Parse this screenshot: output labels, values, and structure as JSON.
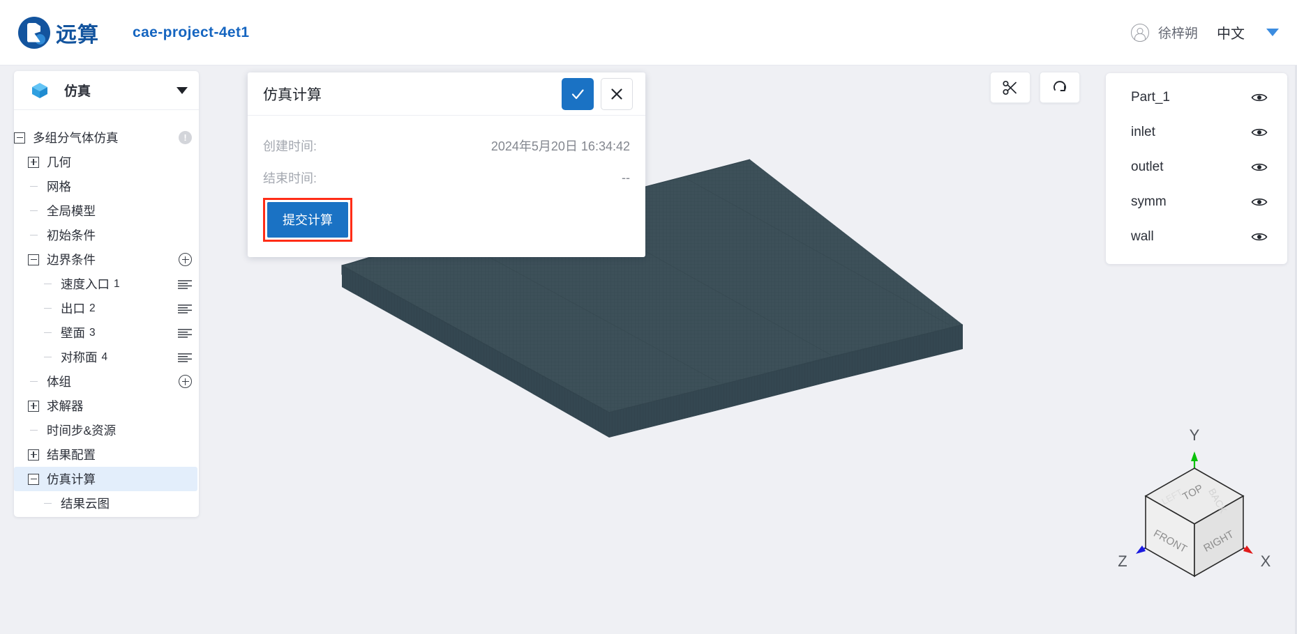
{
  "topbar": {
    "brand_name": "远算",
    "project_title": "cae-project-4et1",
    "user_name": "徐梓朔",
    "language": "中文",
    "avatar_icon": "user-circle-icon",
    "caret_icon": "chevron-down-icon"
  },
  "sidebar": {
    "header_title": "仿真",
    "header_icon": "cube-icon",
    "collapse_icon": "chevron-down-icon",
    "tree": [
      {
        "label": "多组分气体仿真",
        "toggle": "minus",
        "indent": 0,
        "badge": "!",
        "selected": false
      },
      {
        "label": "几何",
        "toggle": "plus",
        "indent": 1,
        "selected": false
      },
      {
        "label": "网格",
        "toggle": "stub",
        "indent": 1,
        "selected": false
      },
      {
        "label": "全局模型",
        "toggle": "stub",
        "indent": 1,
        "selected": false
      },
      {
        "label": "初始条件",
        "toggle": "stub",
        "indent": 1,
        "selected": false
      },
      {
        "label": "边界条件",
        "toggle": "minus",
        "indent": 1,
        "action": "plus-circle",
        "selected": false
      },
      {
        "label": "速度入口",
        "num": "1",
        "toggle": "stub",
        "indent": 2,
        "action": "list",
        "selected": false
      },
      {
        "label": "出口",
        "num": "2",
        "toggle": "stub",
        "indent": 2,
        "action": "list",
        "selected": false
      },
      {
        "label": "壁面",
        "num": "3",
        "toggle": "stub",
        "indent": 2,
        "action": "list",
        "selected": false
      },
      {
        "label": "对称面",
        "num": "4",
        "toggle": "stub",
        "indent": 2,
        "action": "list",
        "selected": false
      },
      {
        "label": "体组",
        "toggle": "stub",
        "indent": 1,
        "action": "plus-circle",
        "selected": false
      },
      {
        "label": "求解器",
        "toggle": "plus",
        "indent": 1,
        "selected": false
      },
      {
        "label": "时间步&资源",
        "toggle": "stub",
        "indent": 1,
        "selected": false
      },
      {
        "label": "结果配置",
        "toggle": "plus",
        "indent": 1,
        "selected": false
      },
      {
        "label": "仿真计算",
        "toggle": "minus",
        "indent": 1,
        "selected": true
      },
      {
        "label": "结果云图",
        "toggle": "stub",
        "indent": 2,
        "selected": false
      }
    ]
  },
  "dialog": {
    "title": "仿真计算",
    "confirm_icon": "check-icon",
    "cancel_icon": "close-icon",
    "fields": [
      {
        "label": "创建时间:",
        "value": "2024年5月20日 16:34:42"
      },
      {
        "label": "结束时间:",
        "value": "--"
      }
    ],
    "submit_label": "提交计算",
    "highlight_color": "#ff2d17",
    "accent_color": "#1a72c4"
  },
  "view_tools": [
    {
      "icon": "scissors-icon",
      "name": "clip-tool"
    },
    {
      "icon": "rotate-icon",
      "name": "reset-view-tool"
    }
  ],
  "parts_panel": {
    "items": [
      {
        "name": "Part_1",
        "visibility_icon": "eye-icon"
      },
      {
        "name": "inlet",
        "visibility_icon": "eye-icon"
      },
      {
        "name": "outlet",
        "visibility_icon": "eye-icon"
      },
      {
        "name": "symm",
        "visibility_icon": "eye-icon"
      },
      {
        "name": "wall",
        "visibility_icon": "eye-icon"
      }
    ]
  },
  "orientation_cube": {
    "faces": {
      "top": "TOP",
      "front": "FRONT",
      "right": "RIGHT",
      "back": "BACK",
      "left": "LEFT"
    },
    "axes": {
      "x": "X",
      "y": "Y",
      "z": "Z"
    },
    "axis_colors": {
      "x": "#e01b1b",
      "y": "#0ac10a",
      "z": "#1a1ae0"
    }
  },
  "model": {
    "mesh_color": "#3d5059",
    "background_color": "#eff0f4"
  }
}
